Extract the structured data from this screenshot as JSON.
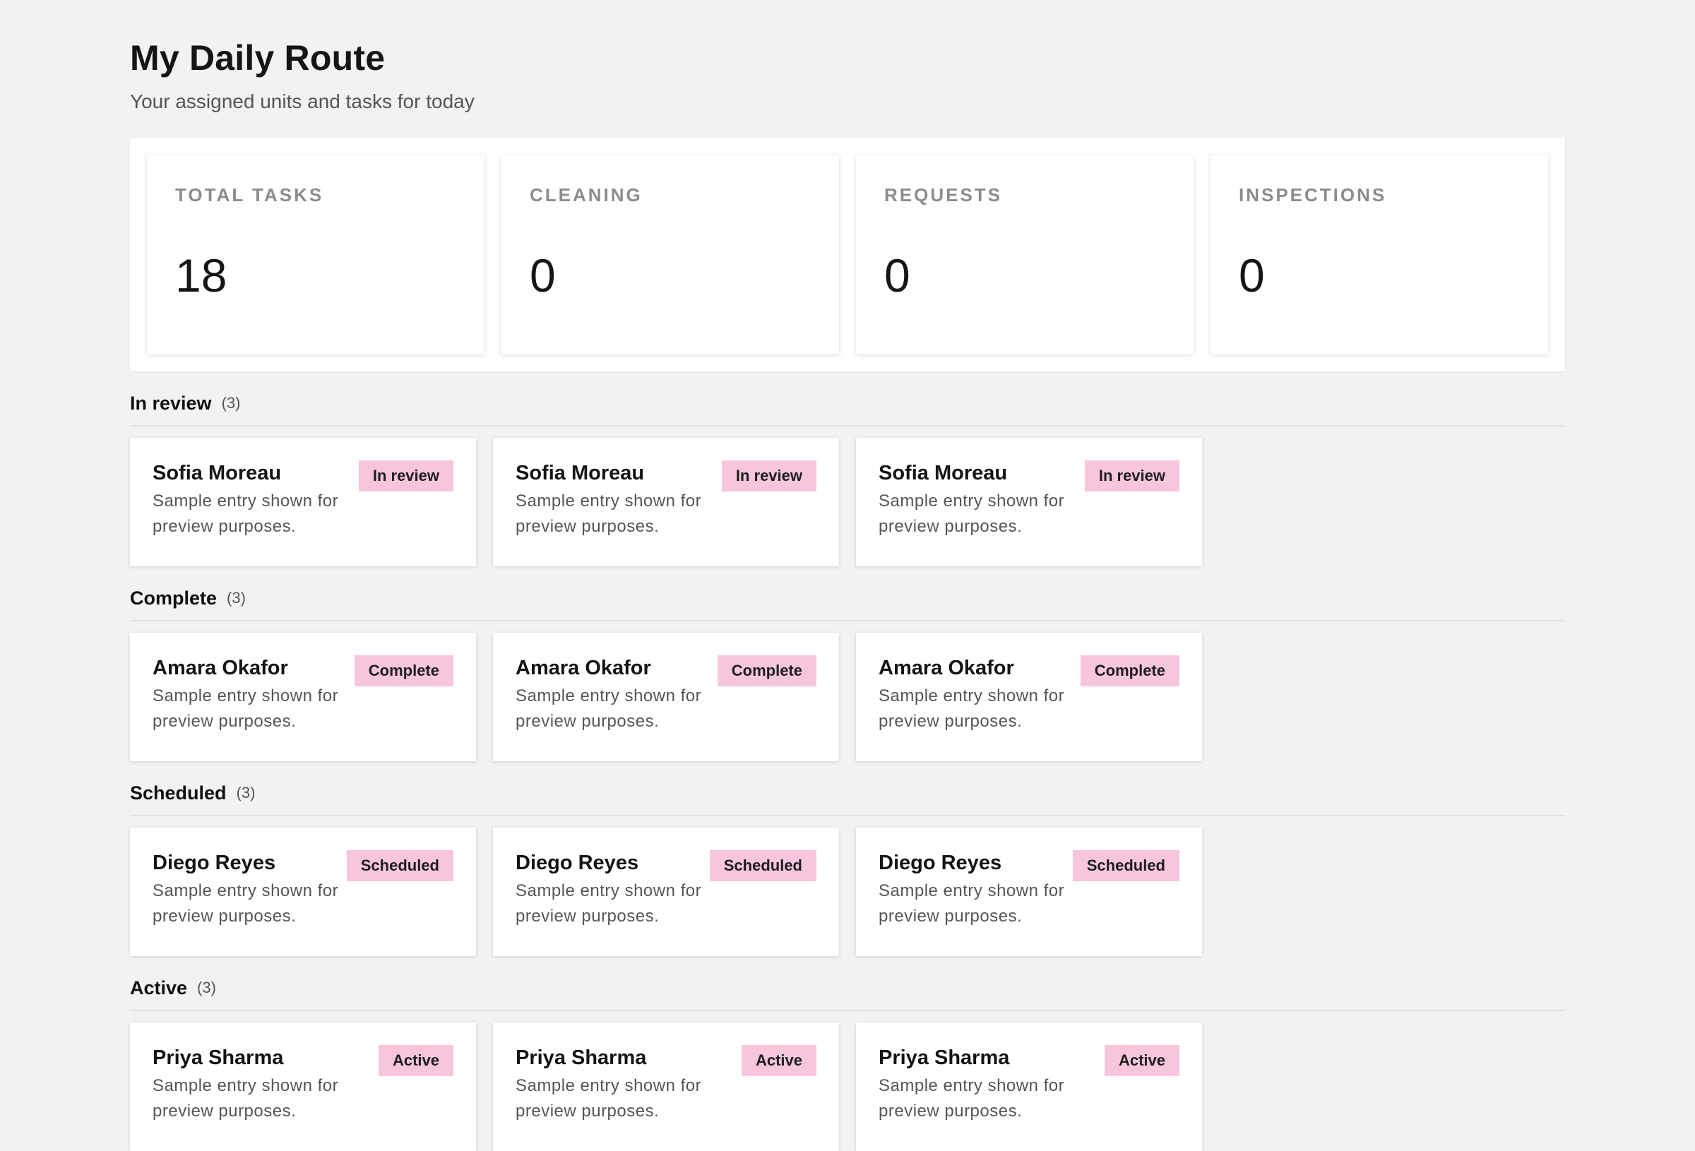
{
  "header": {
    "title": "My Daily Route",
    "subtitle": "Your assigned units and tasks for today"
  },
  "stats": [
    {
      "label": "TOTAL TASKS",
      "value": "18"
    },
    {
      "label": "CLEANING",
      "value": "0"
    },
    {
      "label": "REQUESTS",
      "value": "0"
    },
    {
      "label": "INSPECTIONS",
      "value": "0"
    }
  ],
  "sections": [
    {
      "title": "In review",
      "count": "(3)",
      "cards": [
        {
          "name": "Sofia Moreau",
          "description": "Sample entry shown for preview purposes.",
          "badge": "In review"
        },
        {
          "name": "Sofia Moreau",
          "description": "Sample entry shown for preview purposes.",
          "badge": "In review"
        },
        {
          "name": "Sofia Moreau",
          "description": "Sample entry shown for preview purposes.",
          "badge": "In review"
        }
      ]
    },
    {
      "title": "Complete",
      "count": "(3)",
      "cards": [
        {
          "name": "Amara Okafor",
          "description": "Sample entry shown for preview purposes.",
          "badge": "Complete"
        },
        {
          "name": "Amara Okafor",
          "description": "Sample entry shown for preview purposes.",
          "badge": "Complete"
        },
        {
          "name": "Amara Okafor",
          "description": "Sample entry shown for preview purposes.",
          "badge": "Complete"
        }
      ]
    },
    {
      "title": "Scheduled",
      "count": "(3)",
      "cards": [
        {
          "name": "Diego Reyes",
          "description": "Sample entry shown for preview purposes.",
          "badge": "Scheduled"
        },
        {
          "name": "Diego Reyes",
          "description": "Sample entry shown for preview purposes.",
          "badge": "Scheduled"
        },
        {
          "name": "Diego Reyes",
          "description": "Sample entry shown for preview purposes.",
          "badge": "Scheduled"
        }
      ]
    },
    {
      "title": "Active",
      "count": "(3)",
      "cards": [
        {
          "name": "Priya Sharma",
          "description": "Sample entry shown for preview purposes.",
          "badge": "Active"
        },
        {
          "name": "Priya Sharma",
          "description": "Sample entry shown for preview purposes.",
          "badge": "Active"
        },
        {
          "name": "Priya Sharma",
          "description": "Sample entry shown for preview purposes.",
          "badge": "Active"
        }
      ]
    }
  ],
  "colors": {
    "background": "#f2f2f2",
    "card": "#ffffff",
    "badge": "#f7c6dc",
    "muted_text": "#555555"
  }
}
